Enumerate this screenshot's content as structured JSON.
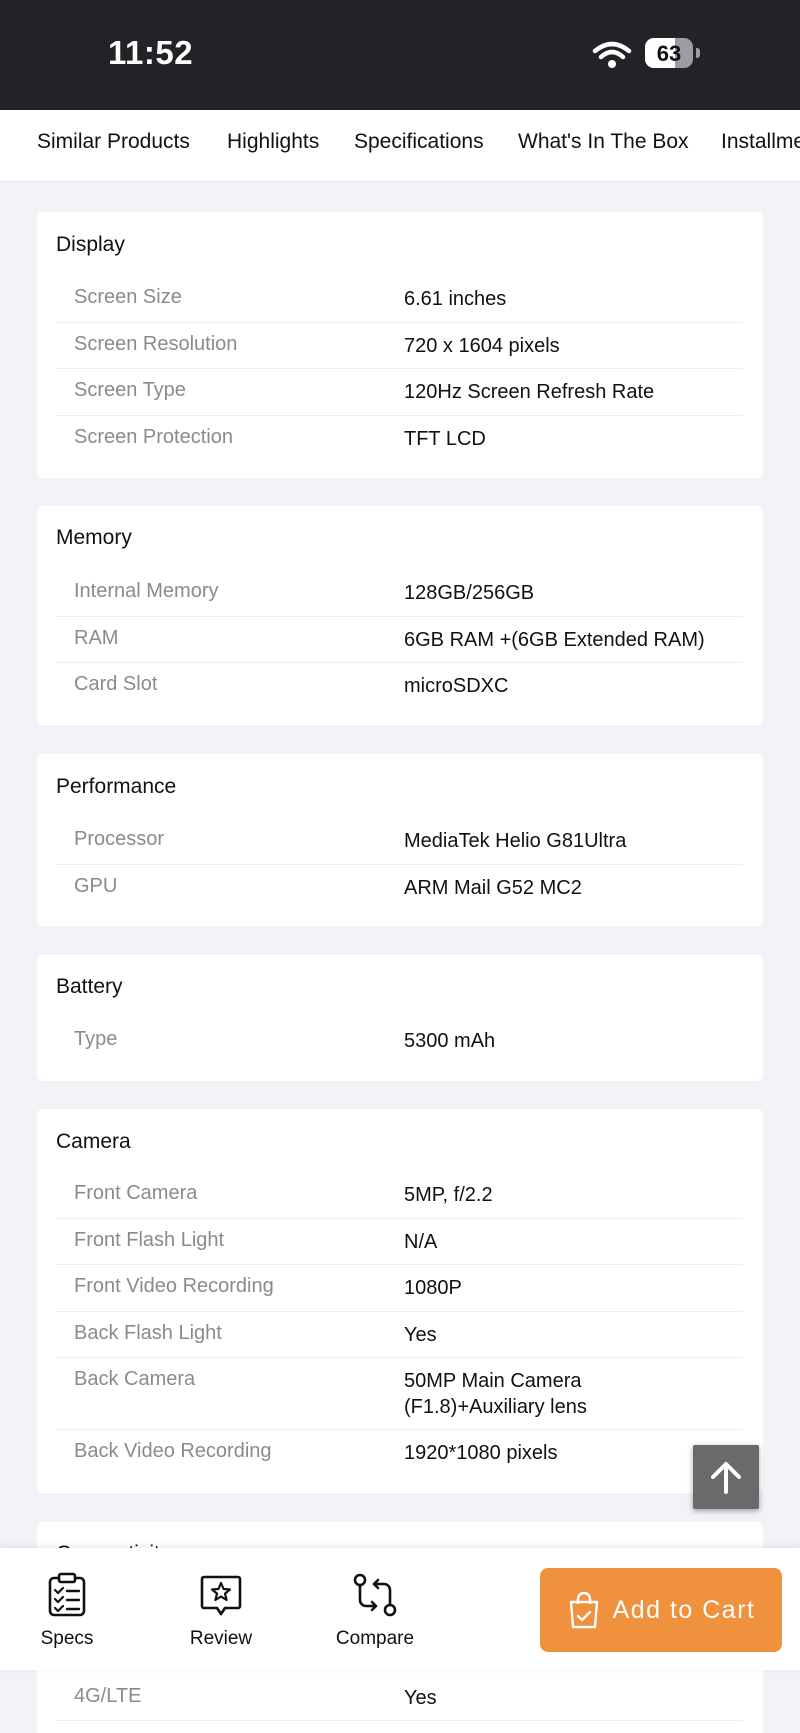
{
  "status": {
    "time": "11:52",
    "battery": "63",
    "battery_level": 0.63
  },
  "tabs": [
    "Similar Products",
    "Highlights",
    "Specifications",
    "What's In The Box",
    "Installment"
  ],
  "sections": [
    {
      "title": "Display",
      "rows": [
        {
          "label": "Screen Size",
          "value": "6.61 inches"
        },
        {
          "label": "Screen Resolution",
          "value": "720 x 1604 pixels"
        },
        {
          "label": "Screen Type",
          "value": "120Hz Screen Refresh Rate"
        },
        {
          "label": "Screen Protection",
          "value": "TFT LCD"
        }
      ]
    },
    {
      "title": "Memory",
      "rows": [
        {
          "label": "Internal Memory",
          "value": "128GB/256GB"
        },
        {
          "label": "RAM",
          "value": "6GB RAM +(6GB Extended RAM)"
        },
        {
          "label": "Card Slot",
          "value": "microSDXC"
        }
      ]
    },
    {
      "title": "Performance",
      "rows": [
        {
          "label": "Processor",
          "value": "MediaTek Helio G81Ultra"
        },
        {
          "label": "GPU",
          "value": "ARM Mail G52 MC2"
        }
      ]
    },
    {
      "title": "Battery",
      "rows": [
        {
          "label": "Type",
          "value": "5300 mAh"
        }
      ]
    },
    {
      "title": "Camera",
      "rows": [
        {
          "label": "Front Camera",
          "value": "5MP, f/2.2"
        },
        {
          "label": "Front Flash Light",
          "value": "N/A"
        },
        {
          "label": "Front Video Recording",
          "value": "1080P"
        },
        {
          "label": "Back Flash Light",
          "value": "Yes"
        },
        {
          "label": "Back Camera",
          "value": "50MP Main Camera (F1.8)+Auxiliary lens"
        },
        {
          "label": "Back Video Recording",
          "value": "1920*1080 pixels"
        }
      ]
    },
    {
      "title": "Connectivity",
      "rows": [
        {
          "label": "4G/LTE",
          "value": "Yes"
        }
      ]
    }
  ],
  "bottom_nav": {
    "specs": "Specs",
    "review": "Review",
    "compare": "Compare",
    "add_to_cart": "Add to Cart"
  },
  "colors": {
    "accent": "#f0913e",
    "status_bar": "#222327",
    "background": "#f2f3f7"
  }
}
